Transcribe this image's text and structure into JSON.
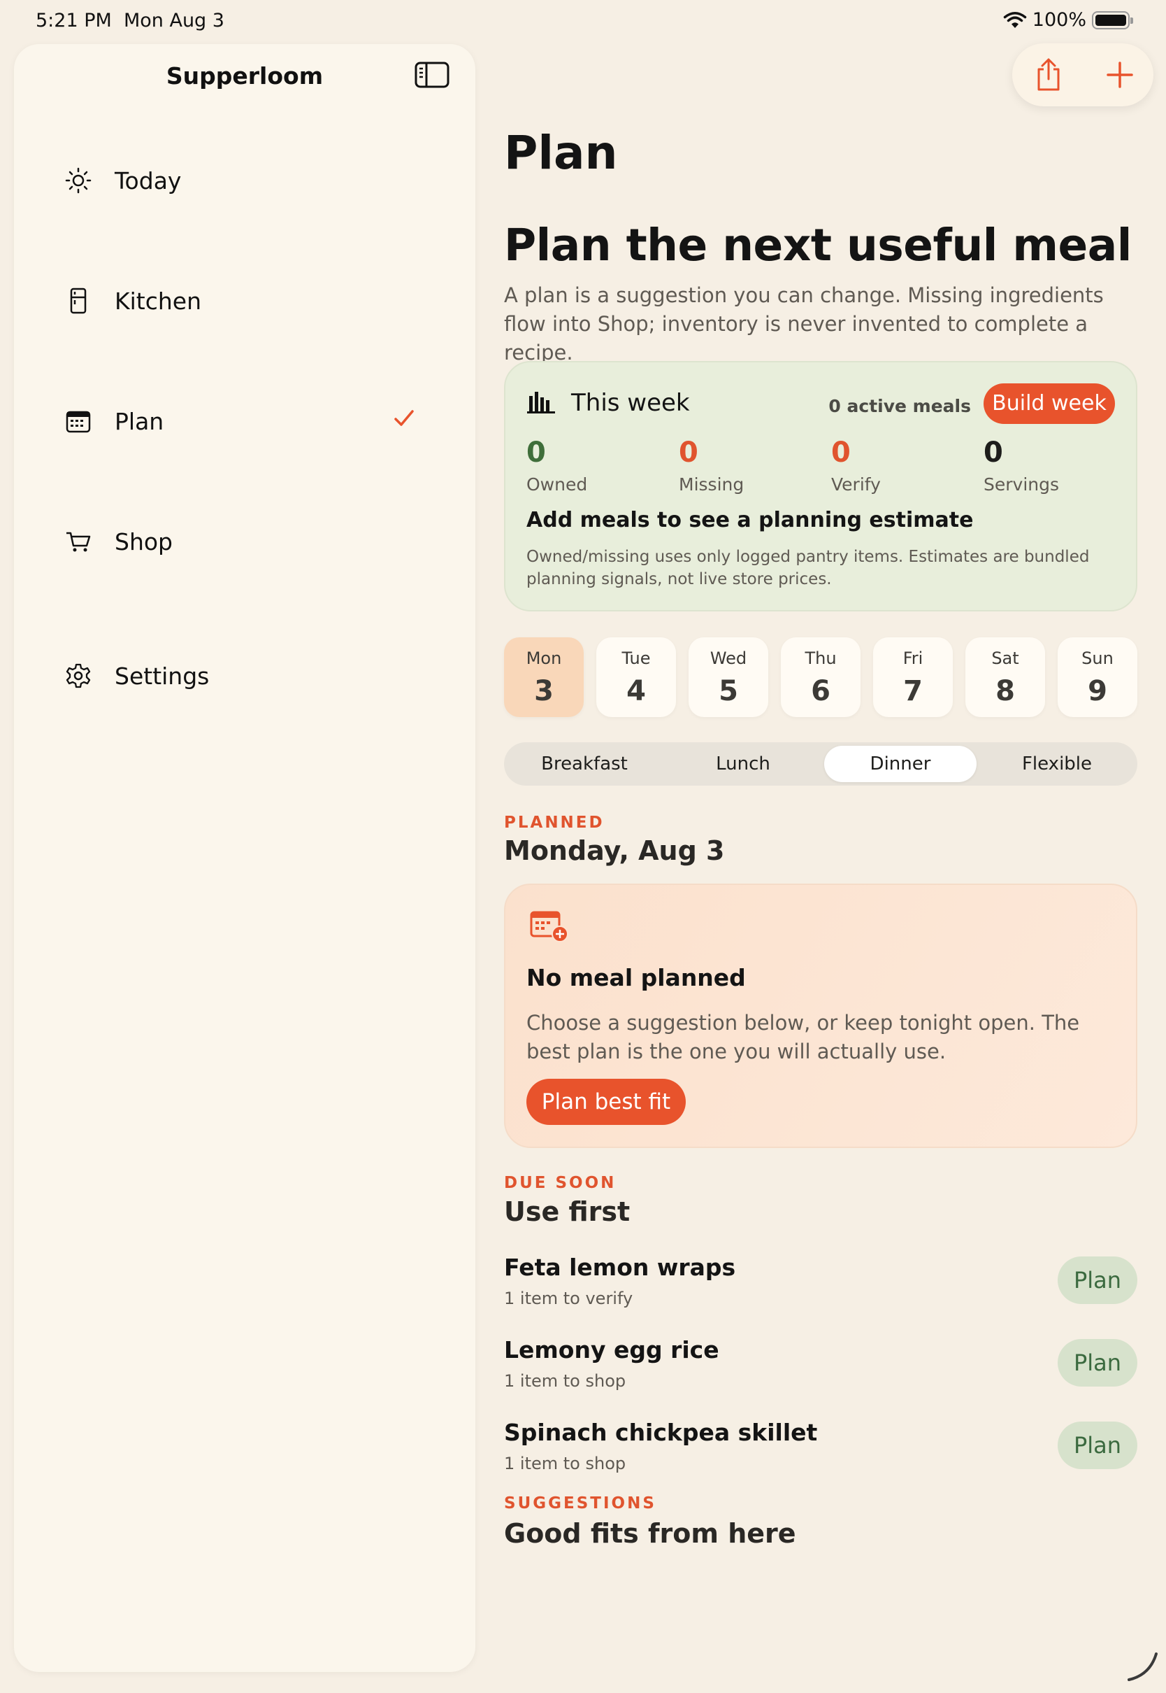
{
  "status_bar": {
    "time": "5:21 PM",
    "date": "Mon Aug 3",
    "battery": "100%"
  },
  "sidebar": {
    "title": "Supperloom",
    "items": [
      {
        "label": "Today",
        "icon": "sun-icon",
        "selected": false
      },
      {
        "label": "Kitchen",
        "icon": "fridge-icon",
        "selected": false
      },
      {
        "label": "Plan",
        "icon": "calendar-icon",
        "selected": true
      },
      {
        "label": "Shop",
        "icon": "cart-icon",
        "selected": false
      },
      {
        "label": "Settings",
        "icon": "gear-icon",
        "selected": false
      }
    ]
  },
  "toolbar": {
    "share_icon": "share-icon",
    "add_icon": "plus-icon"
  },
  "page": {
    "title": "Plan"
  },
  "hero": {
    "title": "Plan the next useful meal",
    "description": "A plan is a suggestion you can change. Missing ingredients flow into Shop; inventory is never invented to complete a recipe."
  },
  "week_card": {
    "title": "This week",
    "active_meals": "0 active meals",
    "build_button": "Build week",
    "stats": [
      {
        "value": "0",
        "label": "Owned",
        "color": "#3f6e3a"
      },
      {
        "value": "0",
        "label": "Missing",
        "color": "#e0542e"
      },
      {
        "value": "0",
        "label": "Verify",
        "color": "#e0542e"
      },
      {
        "value": "0",
        "label": "Servings",
        "color": "#1d1d1b"
      }
    ],
    "estimate_title": "Add meals to see a planning estimate",
    "estimate_note": "Owned/missing uses only logged pantry items. Estimates are bundled planning signals, not live store prices."
  },
  "days": [
    {
      "name": "Mon",
      "num": "3",
      "selected": true
    },
    {
      "name": "Tue",
      "num": "4"
    },
    {
      "name": "Wed",
      "num": "5"
    },
    {
      "name": "Thu",
      "num": "6"
    },
    {
      "name": "Fri",
      "num": "7"
    },
    {
      "name": "Sat",
      "num": "8"
    },
    {
      "name": "Sun",
      "num": "9"
    }
  ],
  "meal_segments": {
    "options": [
      "Breakfast",
      "Lunch",
      "Dinner",
      "Flexible"
    ],
    "selected": "Dinner"
  },
  "planned": {
    "kicker": "PLANNED",
    "date": "Monday, Aug 3",
    "empty_title": "No meal planned",
    "empty_desc": "Choose a suggestion below, or keep tonight open. The best plan is the one you will actually use.",
    "plan_best_fit": "Plan best fit"
  },
  "due_soon": {
    "kicker": "DUE SOON",
    "title": "Use first",
    "items": [
      {
        "title": "Feta lemon wraps",
        "sub": "1 item to verify",
        "button": "Plan"
      },
      {
        "title": "Lemony egg rice",
        "sub": "1 item to shop",
        "button": "Plan"
      },
      {
        "title": "Spinach chickpea skillet",
        "sub": "1 item to shop",
        "button": "Plan"
      }
    ]
  },
  "suggestions": {
    "kicker": "SUGGESTIONS",
    "title": "Good fits from here"
  },
  "colors": {
    "accent": "#e8532c",
    "green": "#3f6e3a",
    "background": "#f6efe4"
  }
}
